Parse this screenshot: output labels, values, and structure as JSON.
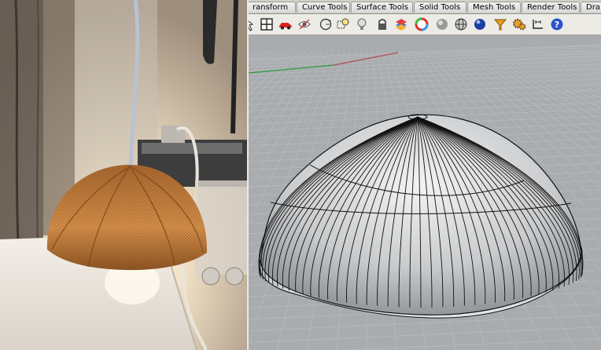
{
  "tabs": [
    {
      "label": "ransform"
    },
    {
      "label": "Curve Tools"
    },
    {
      "label": "Surface Tools"
    },
    {
      "label": "Solid Tools"
    },
    {
      "label": "Mesh Tools"
    },
    {
      "label": "Render Tools"
    },
    {
      "label": "Dra"
    }
  ],
  "toolbar_icons": [
    "pointer-icon",
    "four-viewports-icon",
    "car-icon",
    "eye-icon",
    "rotate-view-icon",
    "zoom-window-icon",
    "lightbulb-icon",
    "lock-icon",
    "layer-icon",
    "color-wheel-icon",
    "shaded-sphere-icon",
    "wireframe-sphere-icon",
    "render-sphere-icon",
    "selection-filter-icon",
    "gear-icon",
    "dimension-icon",
    "help-icon"
  ],
  "colors": {
    "viewport_bg": "#a9acaf",
    "grid_line": "#b7babd",
    "x_axis": "#b04a4a",
    "y_axis": "#2b9a3a",
    "model_surface": "#c9cbcd",
    "wire": "#111111",
    "photo_wall": "#8a7d70",
    "lampshade": "#c98a42"
  }
}
